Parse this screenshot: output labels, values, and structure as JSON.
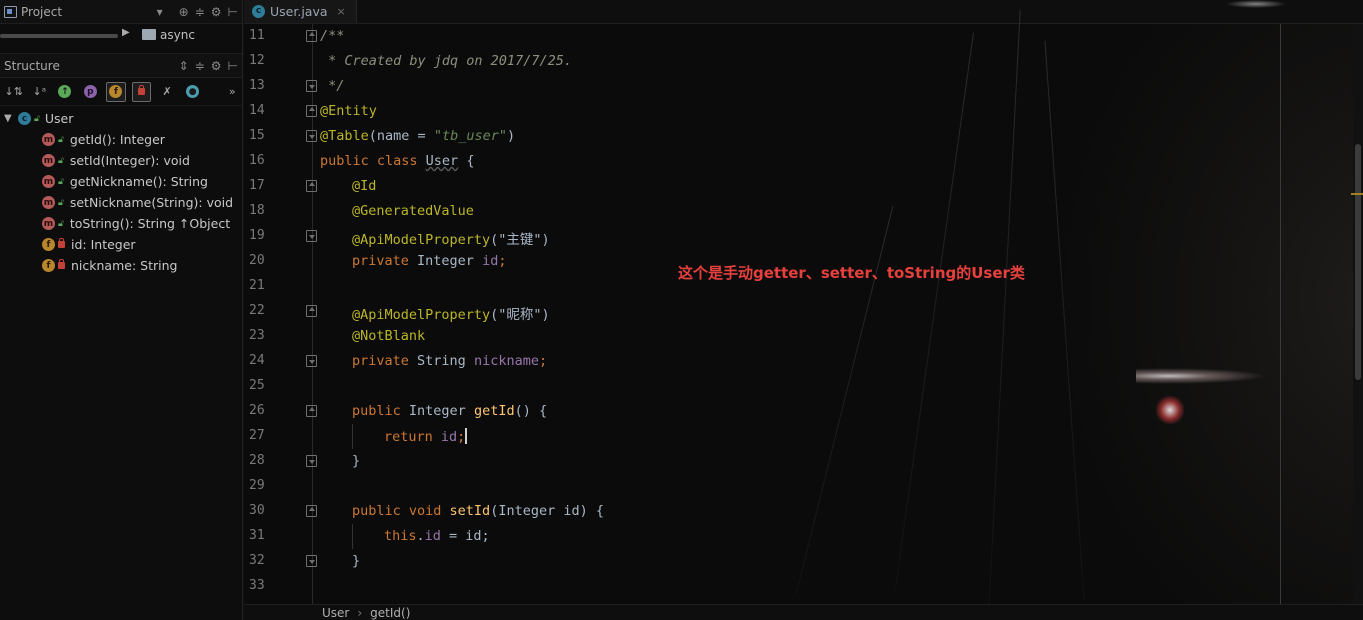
{
  "project_panel": {
    "title": "Project",
    "tree_item": "async"
  },
  "structure_panel": {
    "title": "Structure",
    "root": {
      "label": "User",
      "icon": "class-icon"
    },
    "items": [
      {
        "label": "getId(): Integer",
        "kind": "method"
      },
      {
        "label": "setId(Integer): void",
        "kind": "method"
      },
      {
        "label": "getNickname(): String",
        "kind": "method"
      },
      {
        "label": "setNickname(String): void",
        "kind": "method"
      },
      {
        "label": "toString(): String ↑Object",
        "kind": "method"
      },
      {
        "label": "id: Integer",
        "kind": "field"
      },
      {
        "label": "nickname: String",
        "kind": "field"
      }
    ]
  },
  "editor": {
    "tab": {
      "label": "User.java",
      "close": "×"
    },
    "line_numbers": [
      "11",
      "12",
      "13",
      "14",
      "15",
      "16",
      "17",
      "18",
      "19",
      "20",
      "21",
      "22",
      "23",
      "24",
      "25",
      "26",
      "27",
      "28",
      "29",
      "30",
      "31",
      "32",
      "33"
    ],
    "code": {
      "l11": "/**",
      "l12": " * Created by jdq on 2017/7/25.",
      "l13": " */",
      "l14": "@Entity",
      "l15_ann": "@Table",
      "l15_open": "(name = ",
      "l15_str": "\"tb_user\"",
      "l15_close": ")",
      "l16_kw": "public class ",
      "l16_name": "User",
      "l16_brace": " {",
      "l17": "@Id",
      "l18": "@GeneratedValue",
      "l19_ann": "@ApiModelProperty",
      "l19_str": "(\"主键\")",
      "l20_kw": "private ",
      "l20_type": "Integer ",
      "l20_field": "id",
      "l20_semi": ";",
      "l22_ann": "@ApiModelProperty",
      "l22_str": "(\"昵称\")",
      "l23": "@NotBlank",
      "l24_kw": "private ",
      "l24_type": "String ",
      "l24_field": "nickname",
      "l24_semi": ";",
      "l26_kw": "public ",
      "l26_type": "Integer ",
      "l26_name": "getId",
      "l26_rest": "() {",
      "l27_kw": "return ",
      "l27_field": "id",
      "l27_semi": ";",
      "l28": "}",
      "l30_kw": "public void ",
      "l30_name": "setId",
      "l30_rest": "(Integer id) {",
      "l31_kw": "this",
      "l31_dot": ".",
      "l31_field": "id",
      "l31_rest": " = id;",
      "l32": "}"
    },
    "note": "这个是手动getter、setter、toString的User类",
    "breadcrumb": [
      "User",
      "getId()"
    ]
  },
  "colors": {
    "keyword": "#cc7832",
    "annotation": "#bbb529",
    "string": "#6a8759",
    "field": "#9876aa",
    "method": "#ffc66d",
    "note": "#e8413d"
  }
}
